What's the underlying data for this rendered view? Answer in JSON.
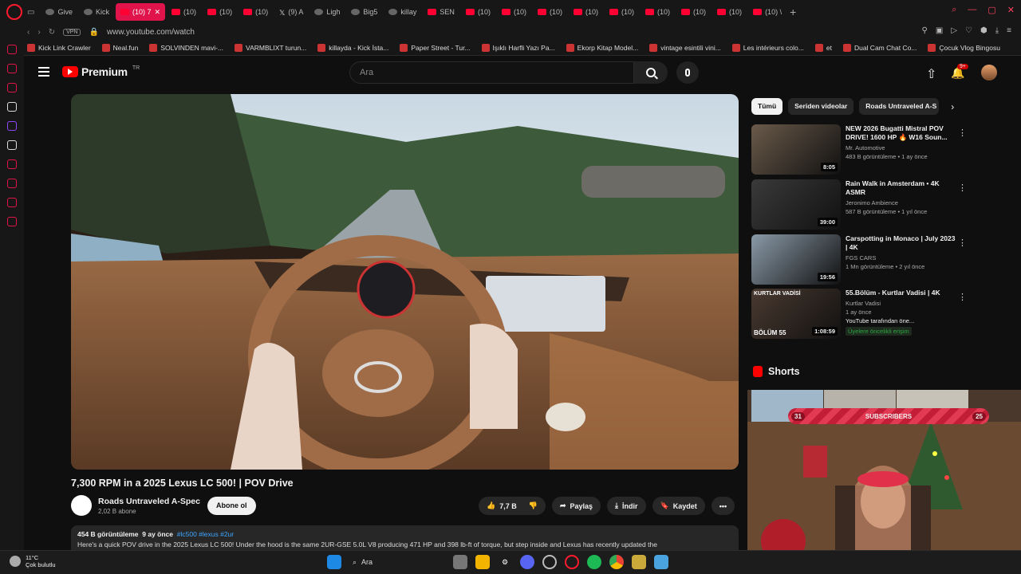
{
  "browser": {
    "tabs": [
      {
        "label": "Give",
        "icon": "github-icon",
        "active": false
      },
      {
        "label": "Kick",
        "icon": "kick-icon",
        "active": false
      },
      {
        "label": "(10) 7",
        "icon": "youtube-icon",
        "active": true
      },
      {
        "label": "(10)",
        "icon": "youtube-icon",
        "active": false
      },
      {
        "label": "(10)",
        "icon": "youtube-icon",
        "active": false
      },
      {
        "label": "(10)",
        "icon": "youtube-icon",
        "active": false
      },
      {
        "label": "(9) A",
        "icon": "x-icon",
        "active": false
      },
      {
        "label": "Ligh",
        "icon": "page-icon",
        "active": false
      },
      {
        "label": "Big5",
        "icon": "page-icon",
        "active": false
      },
      {
        "label": "killay",
        "icon": "page-icon",
        "active": false
      },
      {
        "label": "SEN",
        "icon": "youtube-icon",
        "active": false
      },
      {
        "label": "(10)",
        "icon": "youtube-icon",
        "active": false
      },
      {
        "label": "(10)",
        "icon": "youtube-icon",
        "active": false
      },
      {
        "label": "(10)",
        "icon": "youtube-icon",
        "active": false
      },
      {
        "label": "(10)",
        "icon": "youtube-icon",
        "active": false
      },
      {
        "label": "(10)",
        "icon": "youtube-icon",
        "active": false
      },
      {
        "label": "(10)",
        "icon": "youtube-icon",
        "active": false
      },
      {
        "label": "(10)",
        "icon": "youtube-icon",
        "active": false
      },
      {
        "label": "(10)",
        "icon": "youtube-icon",
        "active": false
      },
      {
        "label": "(10) \\",
        "icon": "youtube-icon",
        "active": false
      }
    ],
    "vpn": "VPN",
    "url": "www.youtube.com/watch",
    "bookmarks": [
      "Kick Link Crawler",
      "Neal.fun",
      "SOLVINDEN mavi-...",
      "VARMBLIXT turun...",
      "killayda - Kick İsta...",
      "Paper Street - Tur...",
      "Işıklı Harfli Yazı Pa...",
      "Ekorp Kitap Model...",
      "vintage esintili vini...",
      "Les intérieurs colo...",
      "et",
      "Dual Cam Chat Co...",
      "Çocuk Vlog Bingosu"
    ]
  },
  "youtube": {
    "logo_text": "Premium",
    "logo_region": "TR",
    "search_placeholder": "Ara",
    "notif_badge": "9+",
    "video": {
      "title": "7,300 RPM in a 2025 Lexus LC 500! | POV Drive",
      "channel": "Roads Untraveled A-Spec",
      "subscribers": "2,02 B abone",
      "subscribe_label": "Abone ol",
      "likes": "7,7 B",
      "share_label": "Paylaş",
      "download_label": "İndir",
      "save_label": "Kaydet",
      "views": "454 B görüntüleme",
      "age": "9 ay önce",
      "tags": "#lc500 #lexus #2ur",
      "description": "Here's a quick POV drive in the 2025 Lexus LC 500! Under the hood is the same 2UR-GSE 5.0L V8 producing 471 HP and 398 lb-ft of torque, but step inside and Lexus has recently updated the"
    },
    "chips": [
      "Tümü",
      "Seriden videolar",
      "Roads Untraveled A-S"
    ],
    "recommendations": [
      {
        "title": "NEW 2026 Bugatti Mistral POV DRIVE! 1600 HP 🔥 W16 Soun...",
        "channel": "Mr. Automotive",
        "meta": "483 B görüntüleme • 1 ay önce",
        "duration": "8:05",
        "thumb_color": "#6a5a4a"
      },
      {
        "title": "Rain Walk in Amsterdam • 4K ASMR",
        "channel": "Jeronimo Ambience",
        "meta": "587 B görüntüleme • 1 yıl önce",
        "duration": "39:00",
        "thumb_color": "#3a3a3a"
      },
      {
        "title": "Carspotting in Monaco | July 2023 | 4K",
        "channel": "FGS CARS",
        "meta": "1 Mn görüntüleme • 2 yıl önce",
        "duration": "19:56",
        "thumb_color": "#8a9aa8"
      },
      {
        "title": "55.Bölüm - Kurtlar Vadisi | 4K",
        "channel": "Kurtlar Vadisi",
        "meta": "1 ay önce",
        "duration": "1:08:59",
        "thumb_color": "#4a3a30",
        "extra": "YouTube tarafından öne...",
        "members": "Üyelere öncelikli erişim",
        "thumb_label": "BÖLÜM 55",
        "thumb_top_label": "KURTLAR VADİSİ"
      }
    ],
    "shorts_label": "Shorts"
  },
  "overlay": {
    "left_count": "31",
    "label": "SUBSCRIBERS",
    "right_count": "25"
  },
  "taskbar": {
    "temp": "11°C",
    "weather": "Çok bulutlu",
    "search": "Ara"
  }
}
